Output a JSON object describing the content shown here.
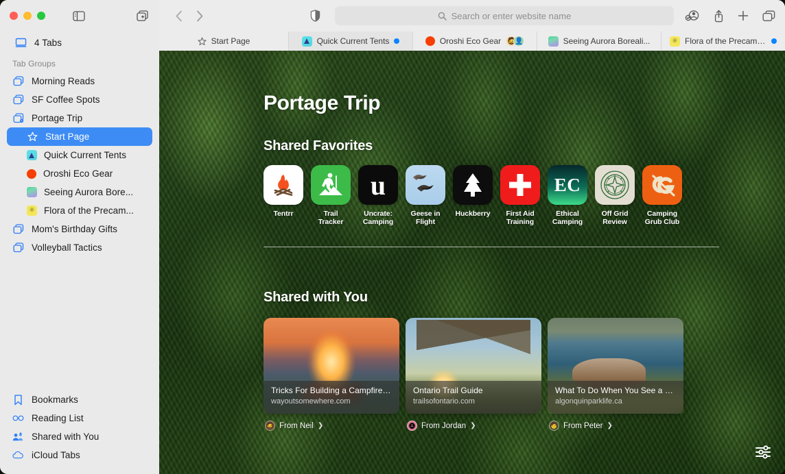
{
  "window": {
    "traffic_lights": [
      "close",
      "minimize",
      "zoom"
    ],
    "sidebar_toggle_icon": "sidebar-icon",
    "new_tab_group_icon": "new-tab-group-icon"
  },
  "sidebar": {
    "tabs_count_label": "4 Tabs",
    "tabs_count_icon": "display-icon",
    "section_header": "Tab Groups",
    "groups": [
      {
        "label": "Morning Reads",
        "icon": "tab-group-icon"
      },
      {
        "label": "SF Coffee Spots",
        "icon": "tab-group-icon"
      },
      {
        "label": "Portage Trip",
        "icon": "tab-group-shared-icon"
      }
    ],
    "portage_children": [
      {
        "label": "Start Page",
        "icon": "star-icon",
        "selected": true
      },
      {
        "label": "Quick Current Tents",
        "icon": "favicon-tents"
      },
      {
        "label": "Oroshi Eco Gear",
        "icon": "favicon-oroshi"
      },
      {
        "label": "Seeing Aurora Bore...",
        "icon": "favicon-aurora"
      },
      {
        "label": "Flora of the Precam...",
        "icon": "favicon-flora"
      }
    ],
    "groups_after": [
      {
        "label": "Mom's Birthday Gifts",
        "icon": "tab-group-icon"
      },
      {
        "label": "Volleyball Tactics",
        "icon": "tab-group-icon"
      }
    ],
    "bottom_items": [
      {
        "label": "Bookmarks",
        "icon": "bookmark-icon"
      },
      {
        "label": "Reading List",
        "icon": "glasses-icon"
      },
      {
        "label": "Shared with You",
        "icon": "shared-people-icon"
      },
      {
        "label": "iCloud Tabs",
        "icon": "cloud-icon"
      }
    ]
  },
  "toolbar": {
    "back_icon": "chevron-left-icon",
    "forward_icon": "chevron-right-icon",
    "privacy_icon": "shield-icon",
    "search_placeholder": "Search or enter website name",
    "search_value": "",
    "search_icon": "search-icon",
    "actions": [
      {
        "name": "share-participants-icon",
        "label": "Participants"
      },
      {
        "name": "share-icon",
        "label": "Share"
      },
      {
        "name": "new-tab-icon",
        "label": "New Tab"
      },
      {
        "name": "tab-overview-icon",
        "label": "Tab Overview"
      }
    ]
  },
  "tabbar": {
    "start_page": {
      "label": "Start Page",
      "icon": "star-icon"
    },
    "tabs": [
      {
        "label": "Quick Current Tents",
        "icon": "favicon-tents",
        "badge": "blue-dot",
        "active": true
      },
      {
        "label": "Oroshi Eco Gear",
        "icon": "favicon-oroshi",
        "avatars": [
          "participant-1",
          "participant-2"
        ]
      },
      {
        "label": "Seeing Aurora Boreali...",
        "icon": "favicon-aurora"
      },
      {
        "label": "Flora of the Precambi...",
        "icon": "favicon-flora",
        "badge": "blue-dot"
      }
    ]
  },
  "start_page": {
    "title": "Portage Trip",
    "favorites_heading": "Shared Favorites",
    "favorites": [
      {
        "label": "Tentrr",
        "icon": "campfire-icon",
        "tile": "t-tentrr"
      },
      {
        "label": "Trail Tracker",
        "icon": "hiker-icon",
        "tile": "t-trail"
      },
      {
        "label": "Uncrate: Camping",
        "icon": "letter-u-icon",
        "tile": "t-uncrate",
        "glyph": "u"
      },
      {
        "label": "Geese in Flight",
        "icon": "geese-icon",
        "tile": "t-geese"
      },
      {
        "label": "Huckberry",
        "icon": "pine-tree-icon",
        "tile": "t-huck"
      },
      {
        "label": "First Aid Training",
        "icon": "medical-cross-icon",
        "tile": "t-aid"
      },
      {
        "label": "Ethical Camping",
        "icon": "letters-ec-icon",
        "tile": "t-ec",
        "glyph": "EC"
      },
      {
        "label": "Off Grid Review",
        "icon": "compass-icon",
        "tile": "t-offgrid"
      },
      {
        "label": "Camping Grub Club",
        "icon": "cg-monogram-icon",
        "tile": "t-grub"
      }
    ],
    "shared_heading": "Shared with You",
    "shared_cards": [
      {
        "title": "Tricks For Building a Campfire—F...",
        "domain": "wayoutsomewhere.com",
        "from": "From Neil",
        "art": "art-fire",
        "avatar": "neil"
      },
      {
        "title": "Ontario Trail Guide",
        "domain": "trailsofontario.com",
        "from": "From Jordan",
        "art": "art-trail",
        "avatar": "jordan"
      },
      {
        "title": "What To Do When You See a Moo...",
        "domain": "algonquinparklife.ca",
        "from": "From Peter",
        "art": "art-moose",
        "avatar": "peter"
      }
    ],
    "settings_icon": "sliders-icon"
  },
  "colors": {
    "accent": "#3d8cf5",
    "sidebar_bg": "#eaeaea",
    "toolbar_bg": "#ececec",
    "blue_glyph": "#2d7ef7",
    "badge_blue": "#0a84ff"
  }
}
